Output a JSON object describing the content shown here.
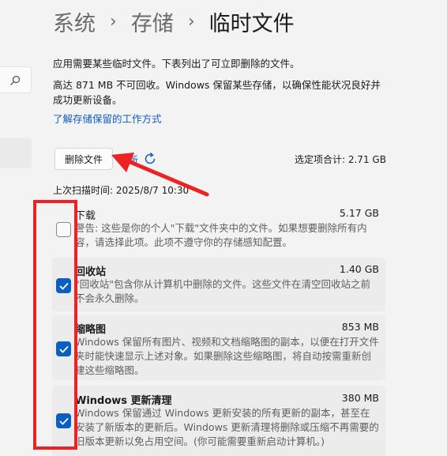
{
  "breadcrumb": {
    "root": "系统",
    "parent": "存储",
    "current": "临时文件"
  },
  "description": "应用需要某些临时文件。下表列出了可立即删除的文件。",
  "reserved_text": "高达 871 MB 不可回收。Windows 保留某些存储，以确保性能状况良好并成功更新设备。",
  "learn_link": "了解存储保留的工作方式",
  "delete_button": "删除文件",
  "refresh_label": "刷新",
  "selected_total": "选定项合计: 2.71 GB",
  "last_scan": "上次扫描时间: 2025/8/7 10:30",
  "items": [
    {
      "title": "下载",
      "size": "5.17 GB",
      "checked": false,
      "desc": "警告: 这些是你的个人\"下载\"文件夹中的文件。如果想要删除所有内容，请选择此项。此项不遵守你的存储感知配置。"
    },
    {
      "title": "回收站",
      "size": "1.40 GB",
      "checked": true,
      "desc": "\"回收站\"包含你从计算机中删除的文件。这些文件在清空回收站之前不会永久删除。"
    },
    {
      "title": "缩略图",
      "size": "853 MB",
      "checked": true,
      "desc": "Windows 保留所有图片、视频和文档缩略图的副本，以便在打开文件夹时能快速显示上述对象。如果删除这些缩略图，将自动按需重新创建这些缩略图。"
    },
    {
      "title": "Windows 更新清理",
      "size": "380 MB",
      "checked": true,
      "desc": "Windows 保留通过 Windows 更新安装的所有更新的副本，甚至在安装了新版本的更新后。Windows 更新清理将删除或压缩不再需要的旧版本更新以免占用空间。(你可能需要重新启动计算机。)"
    }
  ],
  "icons": {
    "search": "search-icon",
    "refresh": "refresh-icon",
    "check": "checkmark-icon"
  },
  "colors": {
    "accent": "#0a5fc0",
    "link": "#0f5cbf",
    "annotation": "#ee2222"
  }
}
